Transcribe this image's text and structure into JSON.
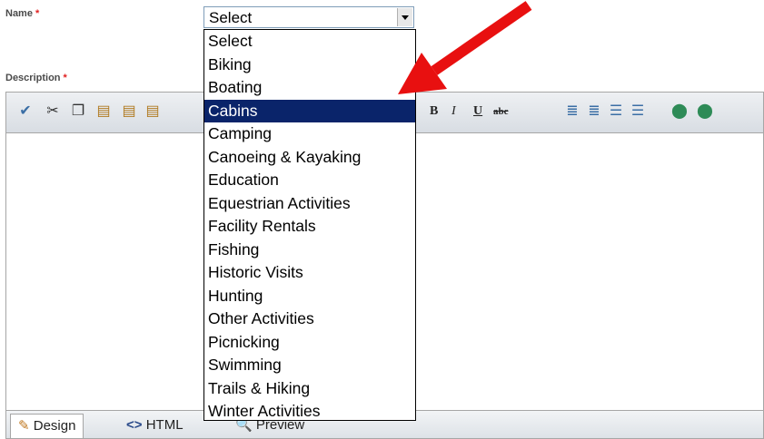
{
  "form": {
    "name_label": "Name",
    "description_label": "Description",
    "required_mark": "*"
  },
  "select": {
    "value": "Select",
    "options": [
      "Select",
      "Biking",
      "Boating",
      "Cabins",
      "Camping",
      "Canoeing & Kayaking",
      "Education",
      "Equestrian Activities",
      "Facility Rentals",
      "Fishing",
      "Historic Visits",
      "Hunting",
      "Other Activities",
      "Picnicking",
      "Swimming",
      "Trails & Hiking",
      "Winter Activities"
    ],
    "highlighted": "Cabins"
  },
  "toolbar": {
    "icons": [
      "spellcheck-icon",
      "cut-icon",
      "copy-icon",
      "paste-icon",
      "paste-word-icon",
      "paste-text-icon"
    ],
    "bold": "B",
    "italic": "I",
    "underline": "U",
    "strike": "abc"
  },
  "footer": {
    "design_tab": "Design",
    "html_tab": "HTML",
    "preview_tab": "Preview"
  },
  "colors": {
    "highlight": "#0a246a",
    "arrow": "#e81010",
    "required": "#e02020"
  }
}
